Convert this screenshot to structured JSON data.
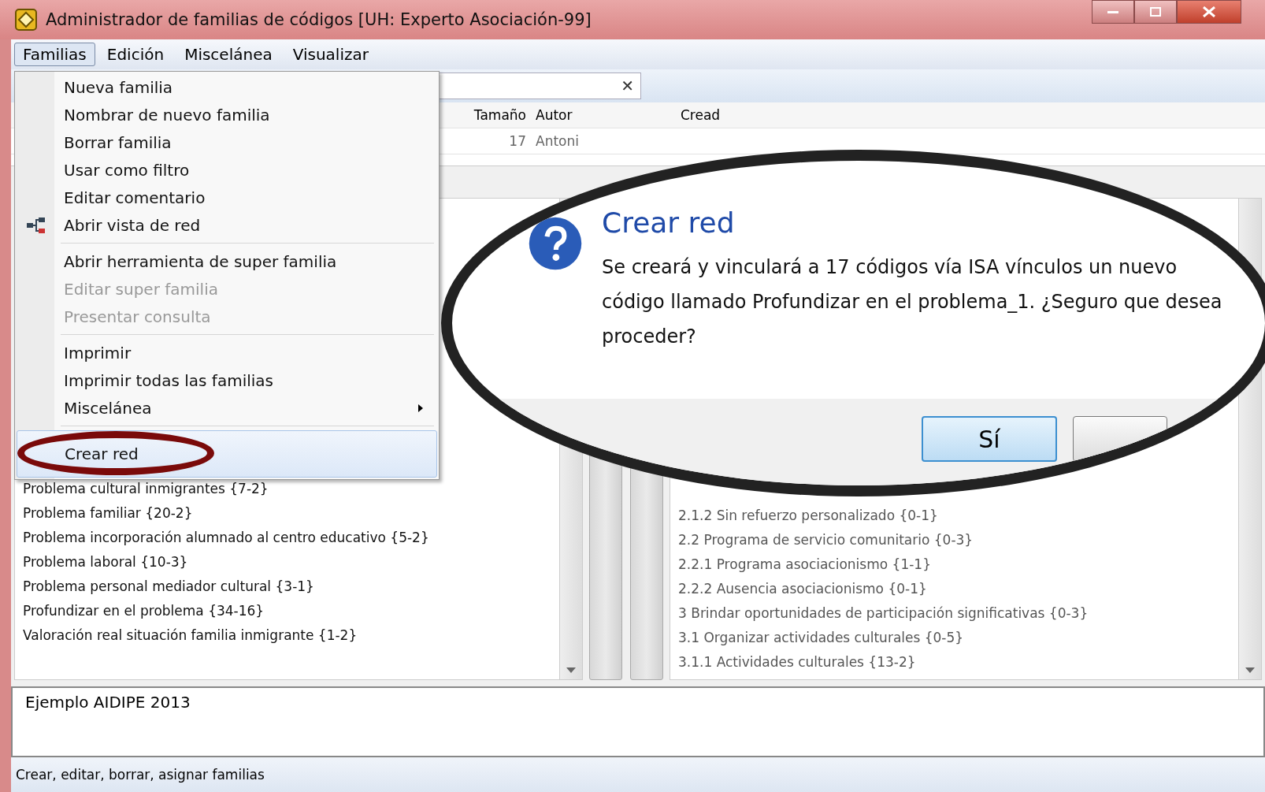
{
  "window": {
    "title": "Administrador de familias de códigos [UH: Experto Asociación-99]"
  },
  "menubar": [
    {
      "label": "Familias",
      "selected": true
    },
    {
      "label": "Edición",
      "selected": false
    },
    {
      "label": "Miscelánea",
      "selected": false
    },
    {
      "label": "Visualizar",
      "selected": false
    }
  ],
  "search": {
    "clear": "✕"
  },
  "table": {
    "columns": [
      "Tamaño",
      "Autor",
      "Cread"
    ],
    "rows": [
      [
        "17",
        "Antoni"
      ]
    ]
  },
  "families_list": [
    "Problema cultural inmigrantes {7-2}",
    "Problema familiar {20-2}",
    "Problema incorporación alumnado al centro educativo {5-2}",
    "Problema laboral {10-3}",
    "Problema personal mediador cultural {3-1}",
    "Profundizar en el problema {34-16}",
    "Valoración real situación familia inmigrante {1-2}"
  ],
  "codes_list": [
    "2.1.2 Sin refuerzo personalizado {0-1}",
    "2.2 Programa de servicio comunitario {0-3}",
    "2.2.1 Programa asociacionismo {1-1}",
    "2.2.2 Ausencia asociacionismo {0-1}",
    "3 Brindar oportunidades de participación significativas {0-3}",
    "3.1 Organizar actividades culturales {0-5}",
    "3.1.1 Actividades culturales {13-2}"
  ],
  "comment": "Ejemplo AIDIPE 2013",
  "status_bar": "Crear, editar, borrar, asignar familias",
  "dropdown_menu": [
    {
      "kind": "item",
      "label": "Nueva familia",
      "disabled": false,
      "selected": false
    },
    {
      "kind": "item",
      "label": "Nombrar de nuevo familia",
      "disabled": false,
      "selected": false
    },
    {
      "kind": "item",
      "label": "Borrar familia",
      "disabled": false,
      "selected": false
    },
    {
      "kind": "item",
      "label": "Usar como filtro",
      "disabled": false,
      "selected": false
    },
    {
      "kind": "item",
      "label": "Editar comentario",
      "disabled": false,
      "selected": false
    },
    {
      "kind": "icon-item",
      "label": "Abrir vista de red",
      "disabled": false,
      "selected": false
    },
    {
      "kind": "separator"
    },
    {
      "kind": "item",
      "label": "Abrir herramienta de super familia",
      "disabled": false,
      "selected": false
    },
    {
      "kind": "item",
      "label": "Editar super familia",
      "disabled": true,
      "selected": false
    },
    {
      "kind": "item",
      "label": "Presentar consulta",
      "disabled": true,
      "selected": false
    },
    {
      "kind": "separator"
    },
    {
      "kind": "item",
      "label": "Imprimir",
      "disabled": false,
      "selected": false
    },
    {
      "kind": "item",
      "label": "Imprimir todas las familias",
      "disabled": false,
      "selected": false
    },
    {
      "kind": "submenu",
      "label": "Miscelánea",
      "disabled": false,
      "selected": false
    },
    {
      "kind": "separator"
    },
    {
      "kind": "item",
      "label": "Crear red",
      "disabled": false,
      "selected": true
    }
  ],
  "dialog": {
    "title": "Crear red",
    "message": "Se creará y vinculará a 17 códigos vía ISA vínculos un nuevo código llamado Profundizar en el problema_1. ¿Seguro que desea proceder?",
    "buttons": [
      "Sí"
    ]
  }
}
